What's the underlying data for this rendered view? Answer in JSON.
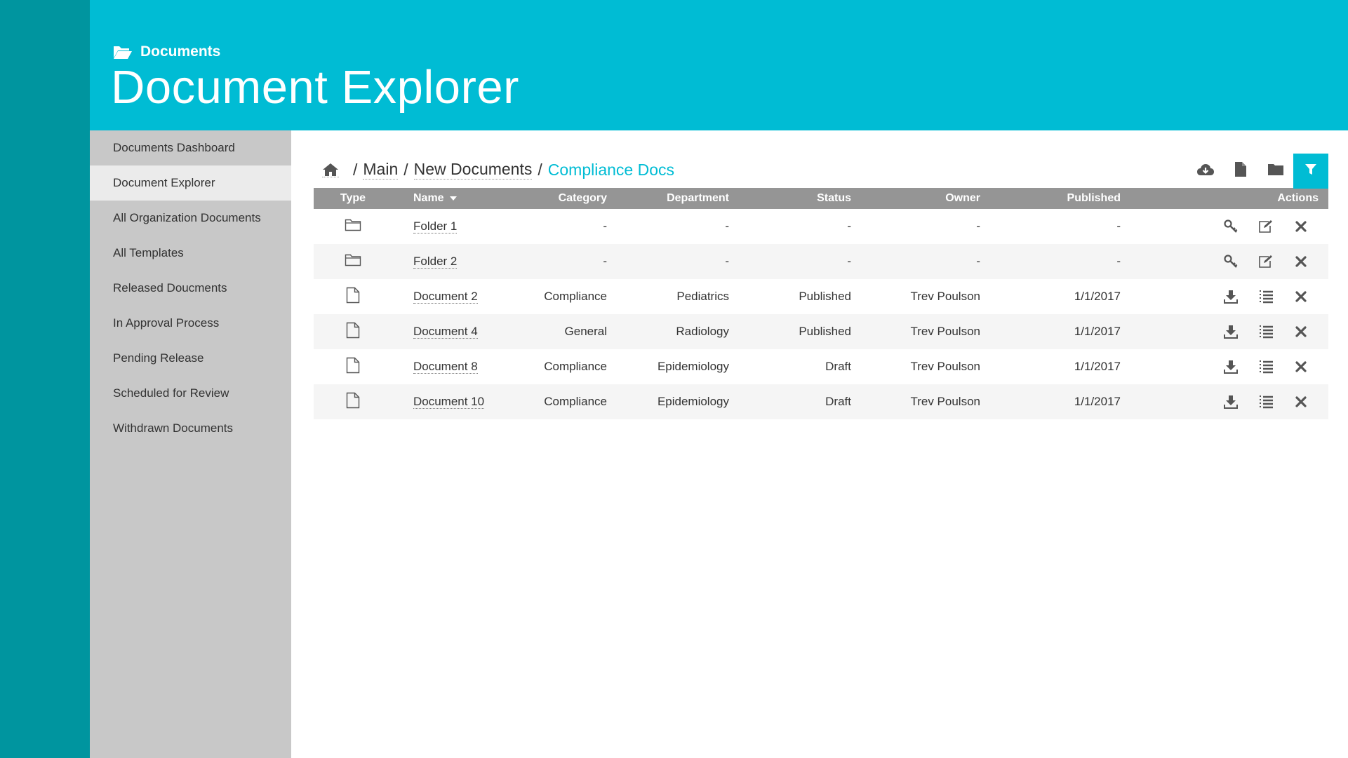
{
  "header": {
    "section_label": "Documents",
    "section_icon": "folder-open-icon",
    "title": "Document Explorer"
  },
  "colors": {
    "accent": "#00bcd4",
    "rail": "#00959f",
    "sidebar": "#c8c8c8",
    "sidebar_active": "#ebebeb",
    "table_header": "#959595"
  },
  "sidebar": {
    "items": [
      {
        "label": "Documents Dashboard",
        "active": false
      },
      {
        "label": "Document Explorer",
        "active": true
      },
      {
        "label": "All Organization Documents",
        "active": false
      },
      {
        "label": "All Templates",
        "active": false
      },
      {
        "label": "Released Doucments",
        "active": false
      },
      {
        "label": "In Approval Process",
        "active": false
      },
      {
        "label": "Pending Release",
        "active": false
      },
      {
        "label": "Scheduled for Review",
        "active": false
      },
      {
        "label": "Withdrawn Documents",
        "active": false
      }
    ]
  },
  "breadcrumb": {
    "home_icon": "home-icon",
    "items": [
      "Main",
      "New Documents"
    ],
    "current": "Compliance Docs"
  },
  "toolbar": {
    "buttons": [
      {
        "icon": "cloud-download-icon",
        "active": false
      },
      {
        "icon": "new-document-icon",
        "active": false
      },
      {
        "icon": "new-folder-icon",
        "active": false
      },
      {
        "icon": "filter-icon",
        "active": true
      }
    ]
  },
  "table": {
    "columns": {
      "type": "Type",
      "name": "Name",
      "category": "Category",
      "department": "Department",
      "status": "Status",
      "owner": "Owner",
      "published": "Published",
      "actions": "Actions"
    },
    "rows": [
      {
        "kind": "folder",
        "name": "Folder 1",
        "category": "-",
        "department": "-",
        "status": "-",
        "owner": "-",
        "published": "-"
      },
      {
        "kind": "folder",
        "name": "Folder 2",
        "category": "-",
        "department": "-",
        "status": "-",
        "owner": "-",
        "published": "-"
      },
      {
        "kind": "document",
        "name": "Document 2",
        "category": "Compliance",
        "department": "Pediatrics",
        "status": "Published",
        "owner": "Trev Poulson",
        "published": "1/1/2017"
      },
      {
        "kind": "document",
        "name": "Document 4",
        "category": "General",
        "department": "Radiology",
        "status": "Published",
        "owner": "Trev Poulson",
        "published": "1/1/2017"
      },
      {
        "kind": "document",
        "name": "Document 8",
        "category": "Compliance",
        "department": "Epidemiology",
        "status": "Draft",
        "owner": "Trev Poulson",
        "published": "1/1/2017"
      },
      {
        "kind": "document",
        "name": "Document 10",
        "category": "Compliance",
        "department": "Epidemiology",
        "status": "Draft",
        "owner": "Trev Poulson",
        "published": "1/1/2017"
      }
    ],
    "folder_actions": [
      "permissions-key-icon",
      "edit-icon",
      "delete-icon"
    ],
    "document_actions": [
      "download-icon",
      "details-list-icon",
      "delete-icon"
    ]
  }
}
